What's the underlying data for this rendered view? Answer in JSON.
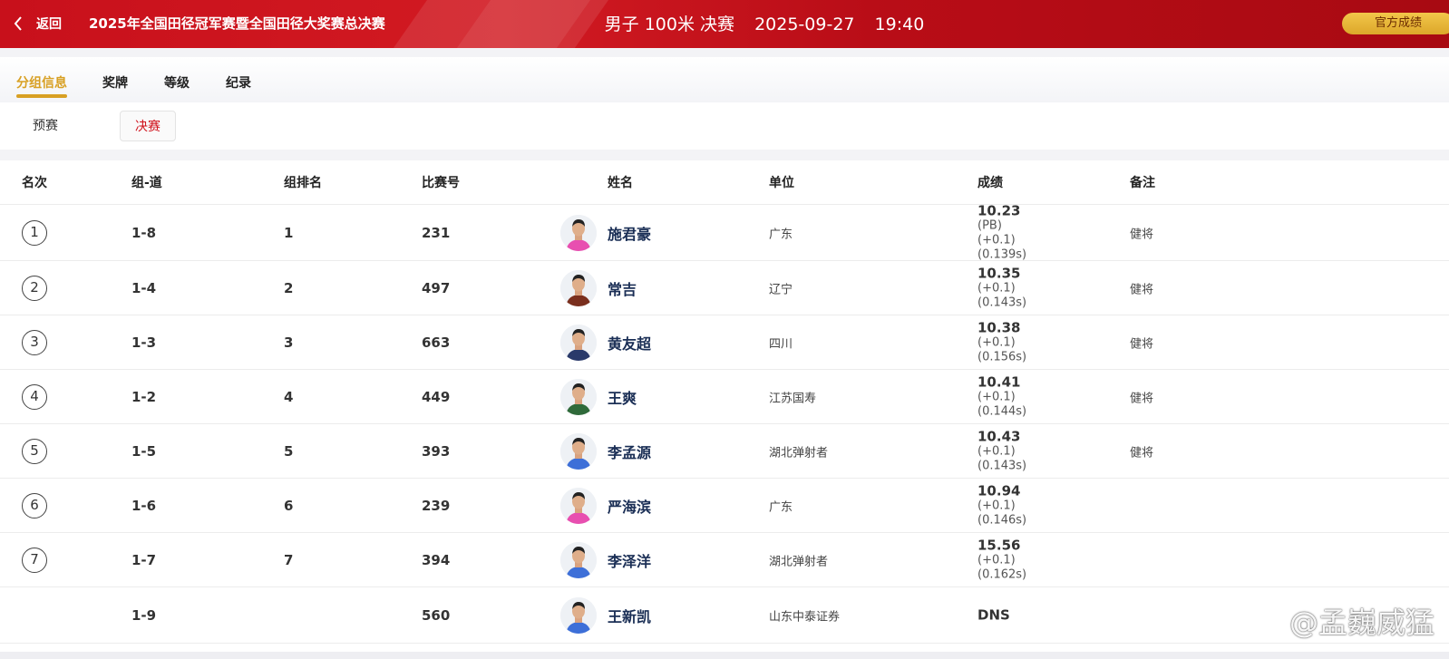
{
  "header": {
    "back_label": "返回",
    "event_name": "2025年全国田径冠军赛暨全国田径大奖赛总决赛",
    "race_name": "男子 100米 决赛",
    "date": "2025-09-27",
    "time": "19:40",
    "official_button": "官方成绩"
  },
  "tabs": [
    "分组信息",
    "奖牌",
    "等级",
    "纪录"
  ],
  "subtabs": {
    "prelim": "预赛",
    "final": "决赛"
  },
  "columns": [
    "名次",
    "组-道",
    "组排名",
    "比赛号",
    "姓名",
    "单位",
    "成绩",
    "备注"
  ],
  "rows": [
    {
      "rank": "1",
      "lane": "1-8",
      "group_rank": "1",
      "bib": "231",
      "name": "施君豪",
      "unit": "广东",
      "result": "10.23",
      "result_lines": [
        "(PB)",
        "(+0.1)",
        "(0.139s)"
      ],
      "remark": "健将",
      "jersey": "#e84fb0"
    },
    {
      "rank": "2",
      "lane": "1-4",
      "group_rank": "2",
      "bib": "497",
      "name": "常吉",
      "unit": "辽宁",
      "result": "10.35",
      "result_lines": [
        "(+0.1)",
        "(0.143s)"
      ],
      "remark": "健将",
      "jersey": "#7a2f1e"
    },
    {
      "rank": "3",
      "lane": "1-3",
      "group_rank": "3",
      "bib": "663",
      "name": "黄友超",
      "unit": "四川",
      "result": "10.38",
      "result_lines": [
        "(+0.1)",
        "(0.156s)"
      ],
      "remark": "健将",
      "jersey": "#2a3a6a"
    },
    {
      "rank": "4",
      "lane": "1-2",
      "group_rank": "4",
      "bib": "449",
      "name": "王爽",
      "unit": "江苏国寿",
      "result": "10.41",
      "result_lines": [
        "(+0.1)",
        "(0.144s)"
      ],
      "remark": "健将",
      "jersey": "#2f6a3a"
    },
    {
      "rank": "5",
      "lane": "1-5",
      "group_rank": "5",
      "bib": "393",
      "name": "李孟源",
      "unit": "湖北弹射者",
      "result": "10.43",
      "result_lines": [
        "(+0.1)",
        "(0.143s)"
      ],
      "remark": "健将",
      "jersey": "#3d6fd8"
    },
    {
      "rank": "6",
      "lane": "1-6",
      "group_rank": "6",
      "bib": "239",
      "name": "严海滨",
      "unit": "广东",
      "result": "10.94",
      "result_lines": [
        "(+0.1)",
        "(0.146s)"
      ],
      "remark": "",
      "jersey": "#e84fb0"
    },
    {
      "rank": "7",
      "lane": "1-7",
      "group_rank": "7",
      "bib": "394",
      "name": "李泽洋",
      "unit": "湖北弹射者",
      "result": "15.56",
      "result_lines": [
        "(+0.1)",
        "(0.162s)"
      ],
      "remark": "",
      "jersey": "#3d6fd8"
    },
    {
      "rank": "",
      "lane": "1-9",
      "group_rank": "",
      "bib": "560",
      "name": "王新凯",
      "unit": "山东中泰证券",
      "result": "DNS",
      "result_lines": [],
      "remark": "",
      "jersey": "#3d6fd8"
    }
  ],
  "watermark": "@孟巍威猛"
}
